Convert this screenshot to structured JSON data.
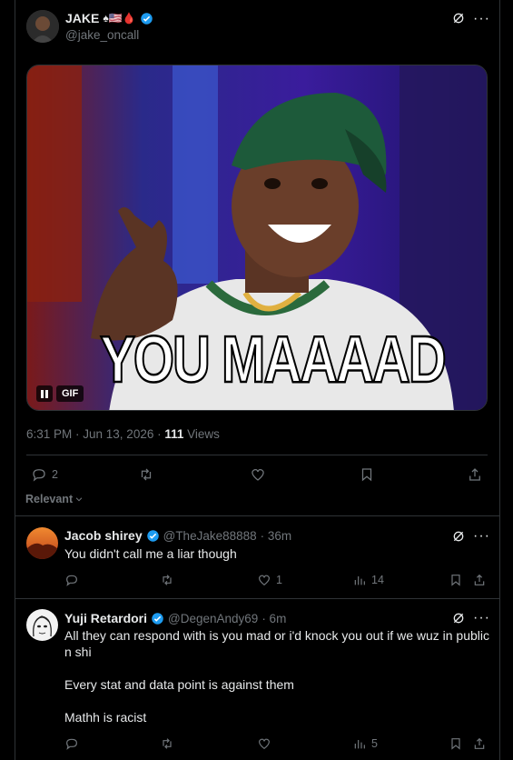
{
  "post": {
    "author_name": "JAKE",
    "author_handle": "@jake_oncall",
    "name_emojis": "♠🇺🇸🩸",
    "gif_caption": "YOU MAAAAD",
    "gif_badge": "GIF",
    "timestamp": "6:31 PM · Jun 13, 2026 · ",
    "views_count": "111",
    "views_label": " Views",
    "stats": {
      "replies": "2",
      "reposts": "",
      "likes": "",
      "bookmarks": ""
    }
  },
  "sort_label": "Relevant",
  "replies": [
    {
      "name": "Jacob shirey",
      "handle": "@TheJake88888",
      "time": "· 36m",
      "text": "You didn't call me a liar though",
      "stats": {
        "replies": "",
        "reposts": "",
        "likes": "1",
        "views": "14"
      }
    },
    {
      "name": "Yuji Retardori",
      "handle": "@DegenAndy69",
      "time": "· 6m",
      "text": "All they can respond with is you mad or i'd knock you out if we wuz in public n shi\n\nEvery stat and data point is against them\n\nMathh is racist",
      "stats": {
        "replies": "",
        "reposts": "",
        "likes": "",
        "views": "5"
      }
    }
  ],
  "colors": {
    "accent": "#1d9bf0",
    "muted": "#71767b",
    "divider": "#2f3336",
    "text": "#e7e9ea"
  }
}
